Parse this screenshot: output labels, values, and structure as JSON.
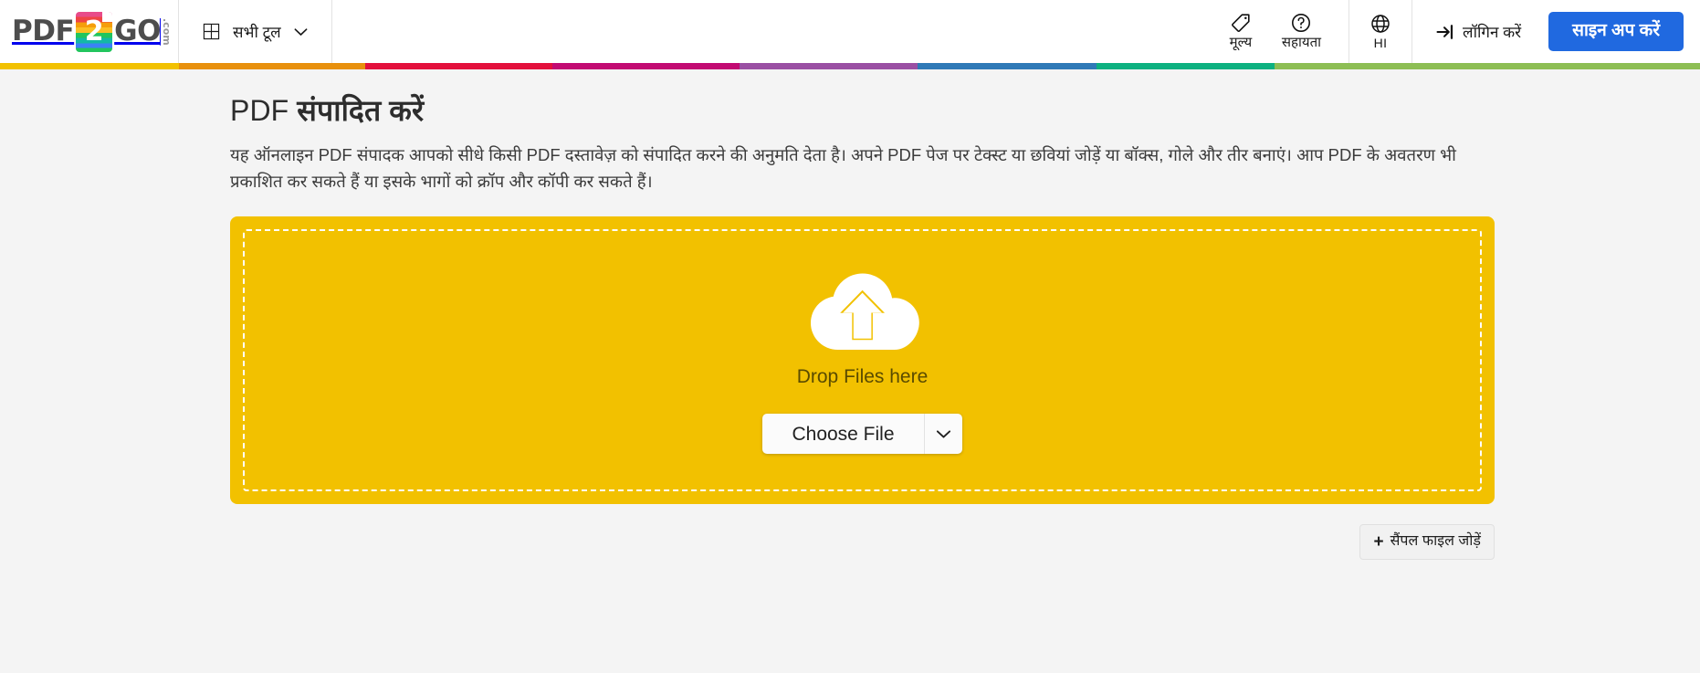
{
  "header": {
    "logo": {
      "left_word": "PDF",
      "mark_char": "2",
      "right_word": "GO",
      "tld": ".com"
    },
    "all_tools_label": "सभी टूल",
    "right_items": [
      {
        "label": "मूल्य",
        "icon": "price-tag-icon"
      },
      {
        "label": "सहायता",
        "icon": "help-circle-icon"
      }
    ],
    "language": {
      "label": "HI",
      "icon": "globe-icon"
    },
    "login_label": "लॉगिन करें",
    "signup_label": "साइन अप करें",
    "accent_color": "#2069e0"
  },
  "stripe": {
    "colors": [
      "#f2c100",
      "#e8900c",
      "#e3103c",
      "#c20a72",
      "#9a4fa3",
      "#2f79b7",
      "#0cb180",
      "#8dbe54"
    ],
    "widths": [
      10.5,
      11,
      11,
      11,
      10.5,
      10.5,
      10.5,
      25
    ]
  },
  "main": {
    "title_plain": "PDF ",
    "title_bold": "संपादित करें",
    "description": "यह ऑनलाइन PDF संपादक आपको सीधे किसी PDF दस्तावेज़ को संपादित करने की अनुमति देता है। अपने PDF पेज पर टेक्स्ट या छवियां जोड़ें या बॉक्स, गोले और तीर बनाएं। आप PDF के अवतरण भी प्रकाशित कर सकते हैं या इसके भागों को क्रॉप और कॉपी कर सकते हैं।",
    "dropzone": {
      "icon": "cloud-upload-icon",
      "drop_text": "Drop Files here",
      "choose_file_label": "Choose File",
      "dropdown_icon": "chevron-down-icon",
      "background_color": "#f2c100"
    },
    "sample_button": {
      "plus": "+",
      "label": "सैंपल फाइल जोड़ें"
    }
  }
}
